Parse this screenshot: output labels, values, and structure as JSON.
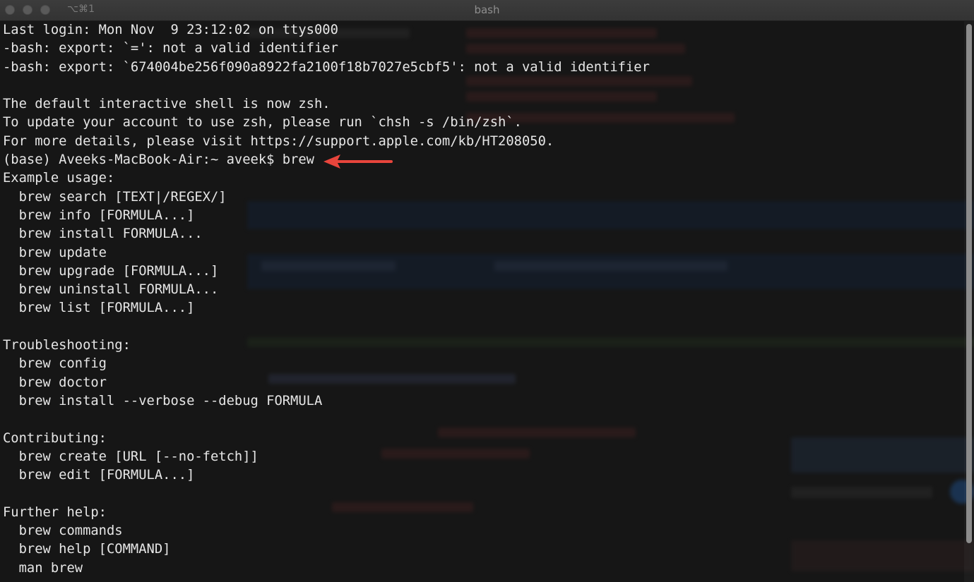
{
  "window": {
    "title": "bash",
    "tab_shortcut": "⌥⌘1"
  },
  "terminal": {
    "lines": [
      "Last login: Mon Nov  9 23:12:02 on ttys000",
      "-bash: export: `=': not a valid identifier",
      "-bash: export: `674004be256f090a8922fa2100f18b7027e5cbf5': not a valid identifier",
      "",
      "The default interactive shell is now zsh.",
      "To update your account to use zsh, please run `chsh -s /bin/zsh`.",
      "For more details, please visit https://support.apple.com/kb/HT208050.",
      "(base) Aveeks-MacBook-Air:~ aveek$ brew",
      "Example usage:",
      "  brew search [TEXT|/REGEX/]",
      "  brew info [FORMULA...]",
      "  brew install FORMULA...",
      "  brew update",
      "  brew upgrade [FORMULA...]",
      "  brew uninstall FORMULA...",
      "  brew list [FORMULA...]",
      "",
      "Troubleshooting:",
      "  brew config",
      "  brew doctor",
      "  brew install --verbose --debug FORMULA",
      "",
      "Contributing:",
      "  brew create [URL [--no-fetch]]",
      "  brew edit [FORMULA...]",
      "",
      "Further help:",
      "  brew commands",
      "  brew help [COMMAND]",
      "  man brew"
    ]
  },
  "annotation": {
    "icon": "red-arrow-icon",
    "color": "#e8453c"
  },
  "colors": {
    "background": "#161616",
    "text": "#e6e6e6",
    "titlebar": "#383838"
  }
}
